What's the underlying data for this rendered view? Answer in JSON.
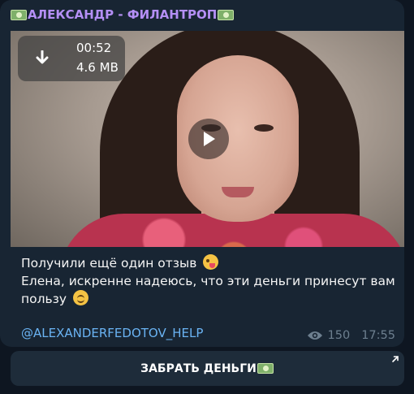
{
  "message": {
    "sender": "АЛЕКСАНДР - ФИЛАНТРОП",
    "video": {
      "duration": "00:52",
      "size": "4.6 MB"
    },
    "caption": {
      "line1": "Получили ещё один отзыв",
      "line2": "Елена, искренне надеюсь, что эти деньги принесут вам",
      "line3": "пользу"
    },
    "link": "@ALEXANDERFEDOTOV_HELP",
    "views": "150",
    "time": "17:55"
  },
  "action_button": {
    "label": "ЗАБРАТЬ ДЕНЬГИ"
  },
  "colors": {
    "background": "#0e1621",
    "bubble": "#182533",
    "sender": "#b48ff5",
    "link": "#6ab3f3",
    "meta": "#6d7f8f"
  },
  "icons": {
    "sender_prefix": "money-bag-emoji-icon",
    "sender_suffix": "money-bag-emoji-icon",
    "download": "download-arrow-icon",
    "play": "play-icon",
    "wink": "winking-face-emoji-icon",
    "smile": "smiling-face-emoji-icon",
    "views": "eye-icon",
    "external": "external-link-arrow-icon",
    "button_suffix": "money-bag-emoji-icon"
  }
}
